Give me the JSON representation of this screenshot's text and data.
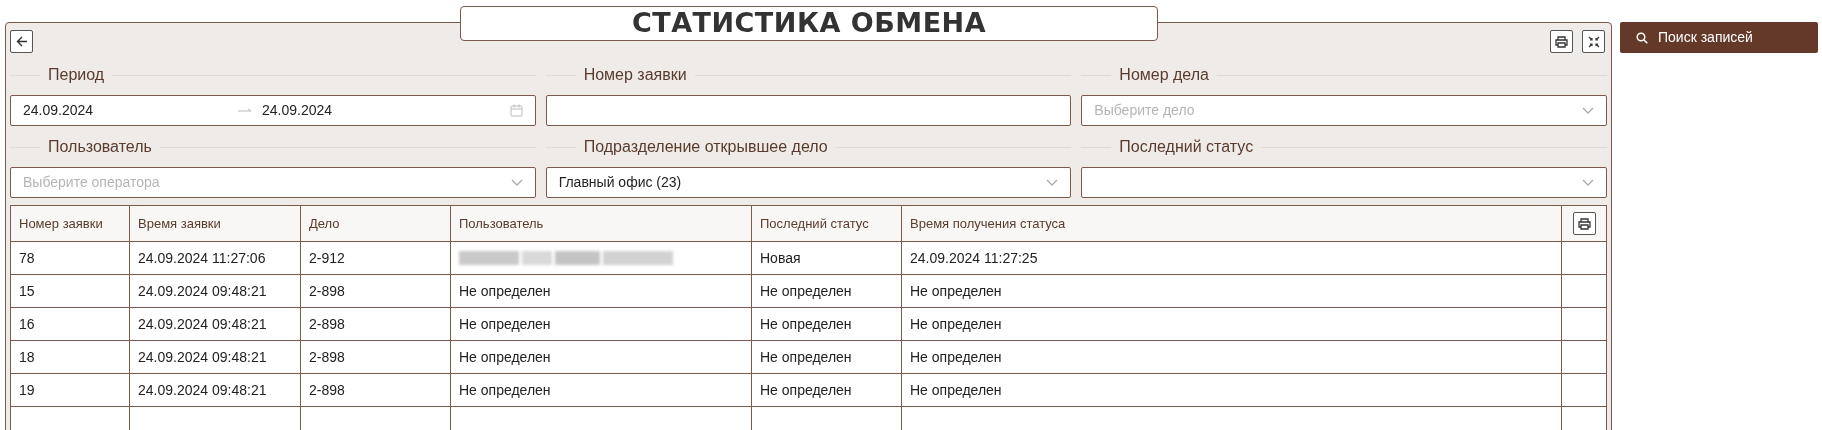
{
  "title": "СТАТИСТИКА ОБМЕНА",
  "search_button": "Поиск записей",
  "filters": [
    {
      "label": "Период",
      "kind": "daterange",
      "from": "24.09.2024",
      "to": "24.09.2024"
    },
    {
      "label": "Номер заявки",
      "kind": "text"
    },
    {
      "label": "Номер дела",
      "kind": "select",
      "placeholder": "Выберите дело"
    },
    {
      "label": "Пользователь",
      "kind": "select",
      "placeholder": "Выберите оператора"
    },
    {
      "label": "Подразделение открывшее дело",
      "kind": "select",
      "value": "Главный офис (23)"
    },
    {
      "label": "Последний статус",
      "kind": "select"
    }
  ],
  "table": {
    "columns": [
      "Номер заявки",
      "Время заявки",
      "Дело",
      "Пользователь",
      "Последний статус",
      "Время получения статуса"
    ],
    "rows": [
      [
        {
          "text": "78"
        },
        {
          "text": "24.09.2024 11:27:06"
        },
        {
          "text": "2-912"
        },
        {
          "kind": "redacted"
        },
        {
          "text": "Новая"
        },
        {
          "text": "24.09.2024 11:27:25"
        }
      ],
      [
        {
          "text": "15"
        },
        {
          "text": "24.09.2024 09:48:21"
        },
        {
          "text": "2-898"
        },
        {
          "text": "Не определен"
        },
        {
          "text": "Не определен"
        },
        {
          "text": "Не определен"
        }
      ],
      [
        {
          "text": "16"
        },
        {
          "text": "24.09.2024 09:48:21"
        },
        {
          "text": "2-898"
        },
        {
          "text": "Не определен"
        },
        {
          "text": "Не определен"
        },
        {
          "text": "Не определен"
        }
      ],
      [
        {
          "text": "18"
        },
        {
          "text": "24.09.2024 09:48:21"
        },
        {
          "text": "2-898"
        },
        {
          "text": "Не определен"
        },
        {
          "text": "Не определен"
        },
        {
          "text": "Не определен"
        }
      ],
      [
        {
          "text": "19"
        },
        {
          "text": "24.09.2024 09:48:21"
        },
        {
          "text": "2-898"
        },
        {
          "text": "Не определен"
        },
        {
          "text": "Не определен"
        },
        {
          "text": "Не определен"
        }
      ]
    ]
  }
}
